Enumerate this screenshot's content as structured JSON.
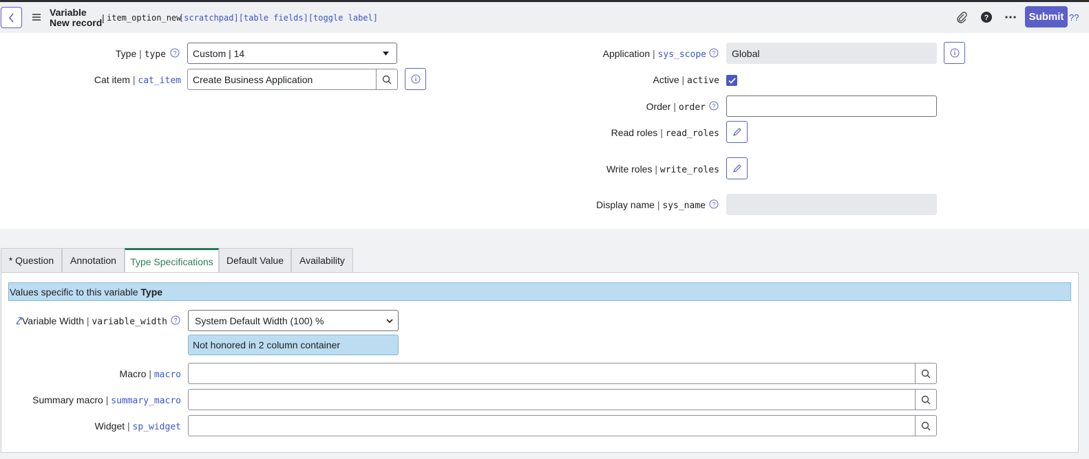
{
  "header": {
    "title_line1": "Variable",
    "title_line2": "New record",
    "separator": "|",
    "table_name": "item_option_new",
    "links": "[scratchpad][table fields][toggle label]",
    "submit_label": "Submit",
    "help_label": "??",
    "icons": [
      "back-icon",
      "menu-icon",
      "attachment-icon",
      "help-icon",
      "more-icon"
    ]
  },
  "form": {
    "type": {
      "label": "Type",
      "field": "type",
      "value": "Custom | 14"
    },
    "cat_item": {
      "label": "Cat item",
      "field": "cat_item",
      "value": "Create Business Application"
    },
    "application": {
      "label": "Application",
      "field": "sys_scope",
      "value": "Global"
    },
    "active": {
      "label": "Active",
      "field": "active",
      "checked": true
    },
    "order": {
      "label": "Order",
      "field": "order",
      "value": ""
    },
    "read_roles": {
      "label": "Read roles",
      "field": "read_roles"
    },
    "write_roles": {
      "label": "Write roles",
      "field": "write_roles"
    },
    "display_name": {
      "label": "Display name",
      "field": "sys_name",
      "value": ""
    }
  },
  "tabs": [
    {
      "label": "* Question",
      "active": false
    },
    {
      "label": "Annotation",
      "active": false
    },
    {
      "label": "Type Specifications",
      "active": true
    },
    {
      "label": "Default Value",
      "active": false
    },
    {
      "label": "Availability",
      "active": false
    }
  ],
  "type_spec": {
    "banner_text": "Values specific to this variable ",
    "banner_bold": "Type",
    "variable_width": {
      "label": "Variable Width",
      "field": "variable_width",
      "value": "System Default Width (100) %",
      "note": "Not honored in 2 column container"
    },
    "macro": {
      "label": "Macro",
      "field": "macro",
      "value": ""
    },
    "summary_macro": {
      "label": "Summary macro",
      "field": "summary_macro",
      "value": ""
    },
    "widget": {
      "label": "Widget",
      "field": "sp_widget",
      "value": ""
    }
  },
  "colors": {
    "accent": "#5b5fc7",
    "active_tab": "#1f7a55",
    "info_bg": "#bcdcf1",
    "link": "#3b55c9"
  }
}
